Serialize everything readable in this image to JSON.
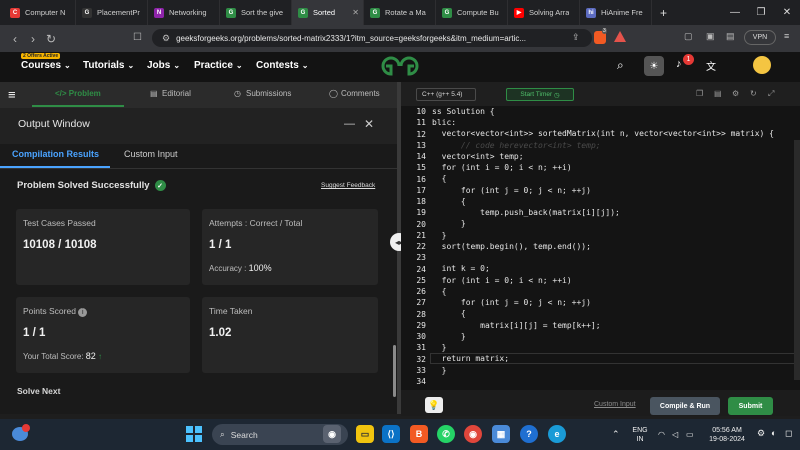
{
  "browser": {
    "tabs": [
      {
        "title": "Computer N",
        "color": "#e53935",
        "letter": "C"
      },
      {
        "title": "PlacementPr",
        "color": "#333333",
        "letter": "G"
      },
      {
        "title": "Networking",
        "color": "#8e24aa",
        "letter": "N"
      },
      {
        "title": "Sort the give",
        "color": "#2f8d46",
        "letter": "G"
      },
      {
        "title": "Sorted",
        "color": "#2f8d46",
        "letter": "G",
        "active": true
      },
      {
        "title": "Rotate a Ma",
        "color": "#2f8d46",
        "letter": "G"
      },
      {
        "title": "Compute Bu",
        "color": "#2f8d46",
        "letter": "G"
      },
      {
        "title": "Solving Arra",
        "color": "#ff0000",
        "letter": "▶"
      },
      {
        "title": "HiAnime Fre",
        "color": "#5c6bc0",
        "letter": "hi"
      }
    ],
    "new_tab": "+",
    "url": "geeksforgeeks.org/problems/sorted-matrix2333/1?itm_source=geeksforgeeks&itm_medium=artic...",
    "vpn_label": "VPN",
    "brave_count": "3"
  },
  "gfg": {
    "logo": "GG",
    "offers_badge": "2 Offers Active",
    "menu": [
      "Courses",
      "Tutorials",
      "Jobs",
      "Practice",
      "Contests"
    ],
    "notif_count": "1"
  },
  "problem_nav": {
    "tabs": [
      "</> Problem",
      "Editorial",
      "Submissions",
      "Comments"
    ]
  },
  "output": {
    "title": "Output Window",
    "tabs": [
      "Compilation Results",
      "Custom Input"
    ],
    "status": "Problem Solved Successfully",
    "suggest": "Suggest Feedback",
    "cards": {
      "tests_label": "Test Cases Passed",
      "tests_value": "10108 / 10108",
      "attempts_label": "Attempts : Correct / Total",
      "attempts_value": "1 / 1",
      "accuracy_label": "Accuracy :",
      "accuracy_value": "100%",
      "points_label": "Points Scored",
      "points_value": "1 / 1",
      "total_score_label": "Your Total Score:",
      "total_score_value": "82",
      "time_label": "Time Taken",
      "time_value": "1.02"
    },
    "solve_next": "Solve Next"
  },
  "editor": {
    "language": "C++ (g++ 5.4)",
    "timer": "Start Timer",
    "line_numbers": [
      "10",
      "11",
      "12",
      "13",
      "14",
      "15",
      "16",
      "17",
      "18",
      "19",
      "20",
      "21",
      "22",
      "23",
      "24",
      "25",
      "26",
      "27",
      "28",
      "29",
      "30",
      "31",
      "32",
      "33",
      "34"
    ],
    "custom_input": "Custom Input",
    "compile_run": "Compile & Run",
    "submit": "Submit"
  },
  "taskbar": {
    "search": "Search",
    "lang_top": "ENG",
    "lang_bottom": "IN",
    "time": "05:56 AM",
    "date": "19-08-2024"
  }
}
